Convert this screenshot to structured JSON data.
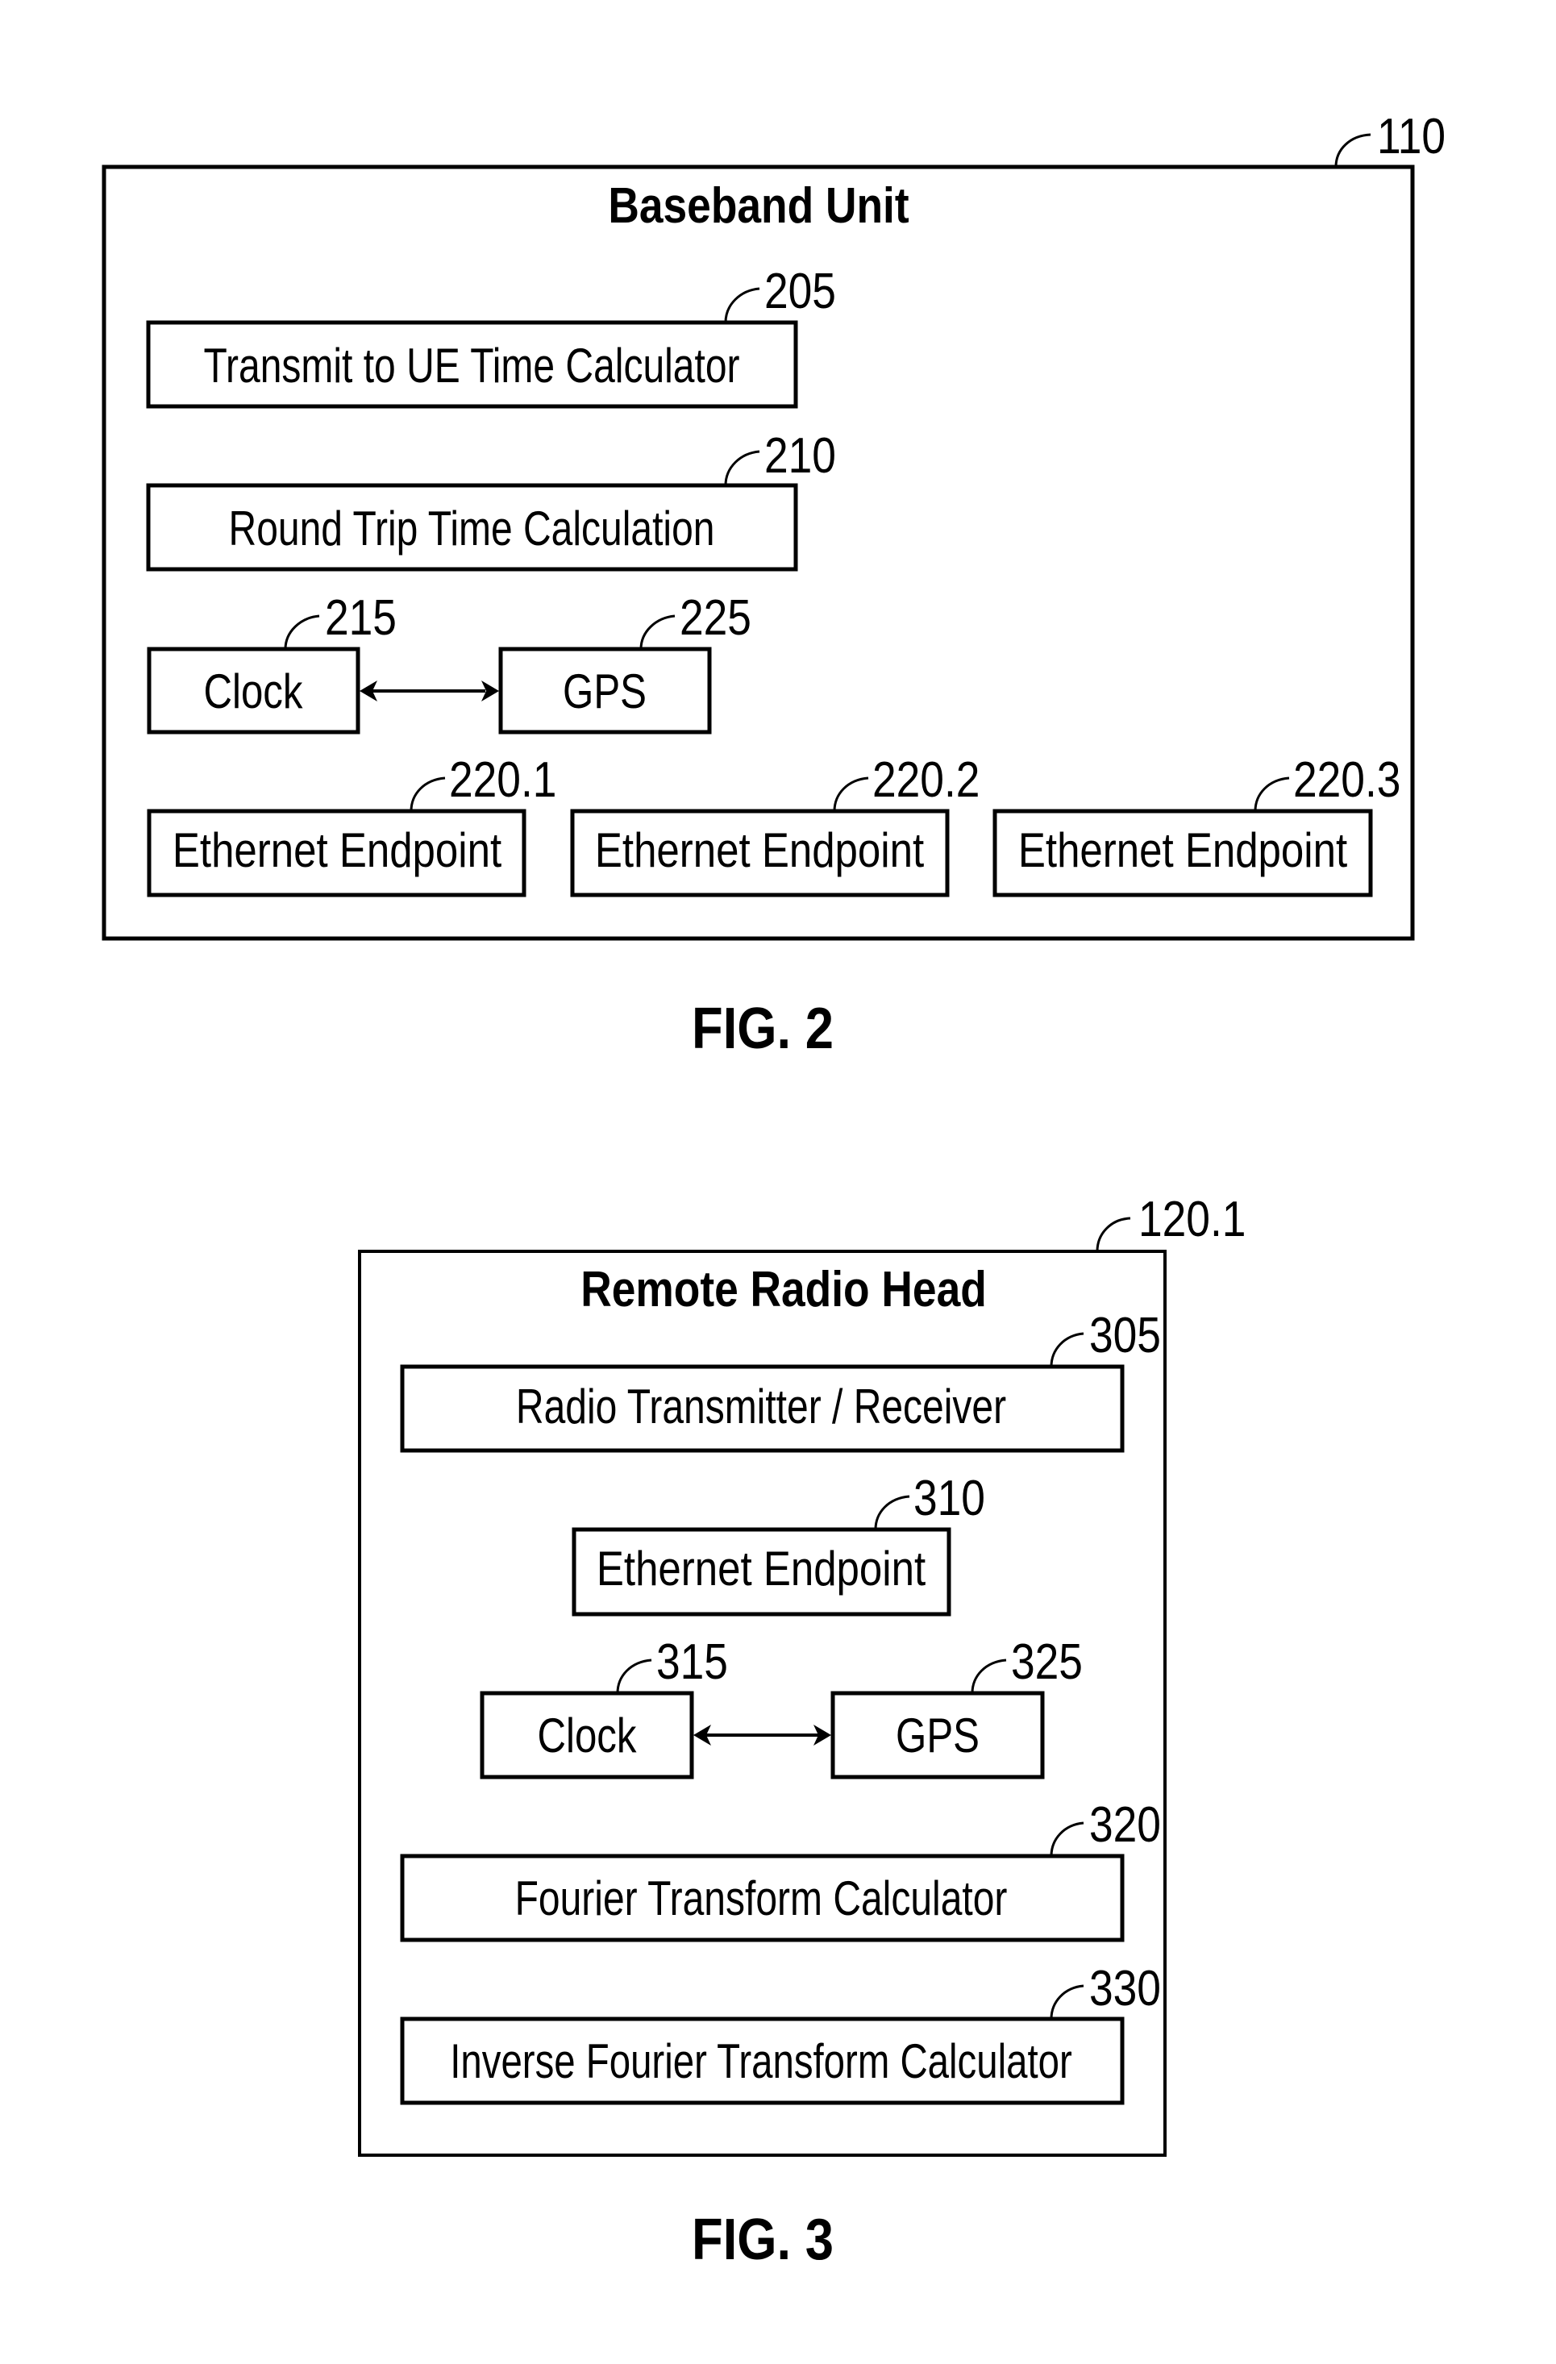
{
  "figures": [
    {
      "id": "fig2",
      "caption": "FIG. 2",
      "container": {
        "title": "Baseband Unit",
        "ref": "110"
      },
      "blocks": [
        {
          "key": "transmit-to-ue-time-calculator",
          "label": "Transmit to UE Time Calculator",
          "ref": "205"
        },
        {
          "key": "round-trip-time-calculation",
          "label": "Round Trip Time Calculation",
          "ref": "210"
        },
        {
          "key": "clock",
          "label": "Clock",
          "ref": "215"
        },
        {
          "key": "gps",
          "label": "GPS",
          "ref": "225"
        },
        {
          "key": "ethernet-endpoint-1",
          "label": "Ethernet Endpoint",
          "ref": "220.1"
        },
        {
          "key": "ethernet-endpoint-2",
          "label": "Ethernet Endpoint",
          "ref": "220.2"
        },
        {
          "key": "ethernet-endpoint-3",
          "label": "Ethernet Endpoint",
          "ref": "220.3"
        }
      ],
      "connections": [
        {
          "from": "clock",
          "to": "gps",
          "type": "bidirectional"
        }
      ]
    },
    {
      "id": "fig3",
      "caption": "FIG. 3",
      "container": {
        "title": "Remote Radio Head",
        "ref": "120.1"
      },
      "blocks": [
        {
          "key": "radio-transmitter-receiver",
          "label": "Radio Transmitter / Receiver",
          "ref": "305"
        },
        {
          "key": "ethernet-endpoint",
          "label": "Ethernet Endpoint",
          "ref": "310"
        },
        {
          "key": "clock",
          "label": "Clock",
          "ref": "315"
        },
        {
          "key": "gps",
          "label": "GPS",
          "ref": "325"
        },
        {
          "key": "fourier-transform-calculator",
          "label": "Fourier Transform Calculator",
          "ref": "320"
        },
        {
          "key": "inverse-fourier-transform-calculator",
          "label": "Inverse Fourier Transform Calculator",
          "ref": "330"
        }
      ],
      "connections": [
        {
          "from": "clock",
          "to": "gps",
          "type": "bidirectional"
        }
      ]
    }
  ]
}
